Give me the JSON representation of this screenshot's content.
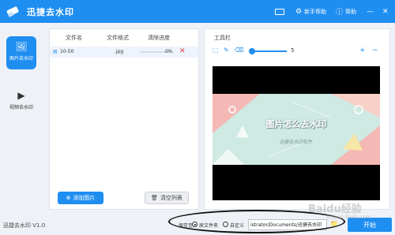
{
  "app": {
    "title": "迅捷去水印",
    "brand_color": "#1f8ef1",
    "logo_icon": "eraser-logo-icon"
  },
  "titlebar": {
    "newbie_label": "新手帮助",
    "help_label": "帮助",
    "minimize_glyph": "—",
    "close_glyph": "✕",
    "gear_glyph": "⚙"
  },
  "sidebar": {
    "items": [
      {
        "label": "图片去水印",
        "icon": "image-icon",
        "glyph": "🖼",
        "active": true
      },
      {
        "label": "视频去水印",
        "icon": "play-icon",
        "glyph": "▶",
        "active": false
      }
    ]
  },
  "file_list": {
    "headers": [
      "文件名",
      "文件格式",
      "清除进度"
    ],
    "rows": [
      {
        "icon": "file-icon",
        "name": "10-50",
        "format": ".jpg",
        "progress": 0,
        "progress_text": "0%",
        "delete_glyph": "✕"
      }
    ],
    "add_button": "添加图片",
    "clear_button": "清空列表"
  },
  "toolbox": {
    "title": "工具栏",
    "brush_size": "5",
    "zoom_in": "+",
    "zoom_out": "−",
    "preview_title": "图片怎么去水印",
    "preview_subtitle": "迅捷去水印软件"
  },
  "bottom": {
    "version": "迅捷去水印 V1.0",
    "save_label": "保存至:",
    "radio_options": [
      {
        "label": "原文件夹",
        "checked": true
      },
      {
        "label": "自定义",
        "checked": false
      }
    ],
    "path_value": "istrator/Documents/迅捷去水印",
    "start_button": "开始",
    "watermark": "Baidu经验",
    "watermark_sub": "jingyan.baidu.com"
  }
}
